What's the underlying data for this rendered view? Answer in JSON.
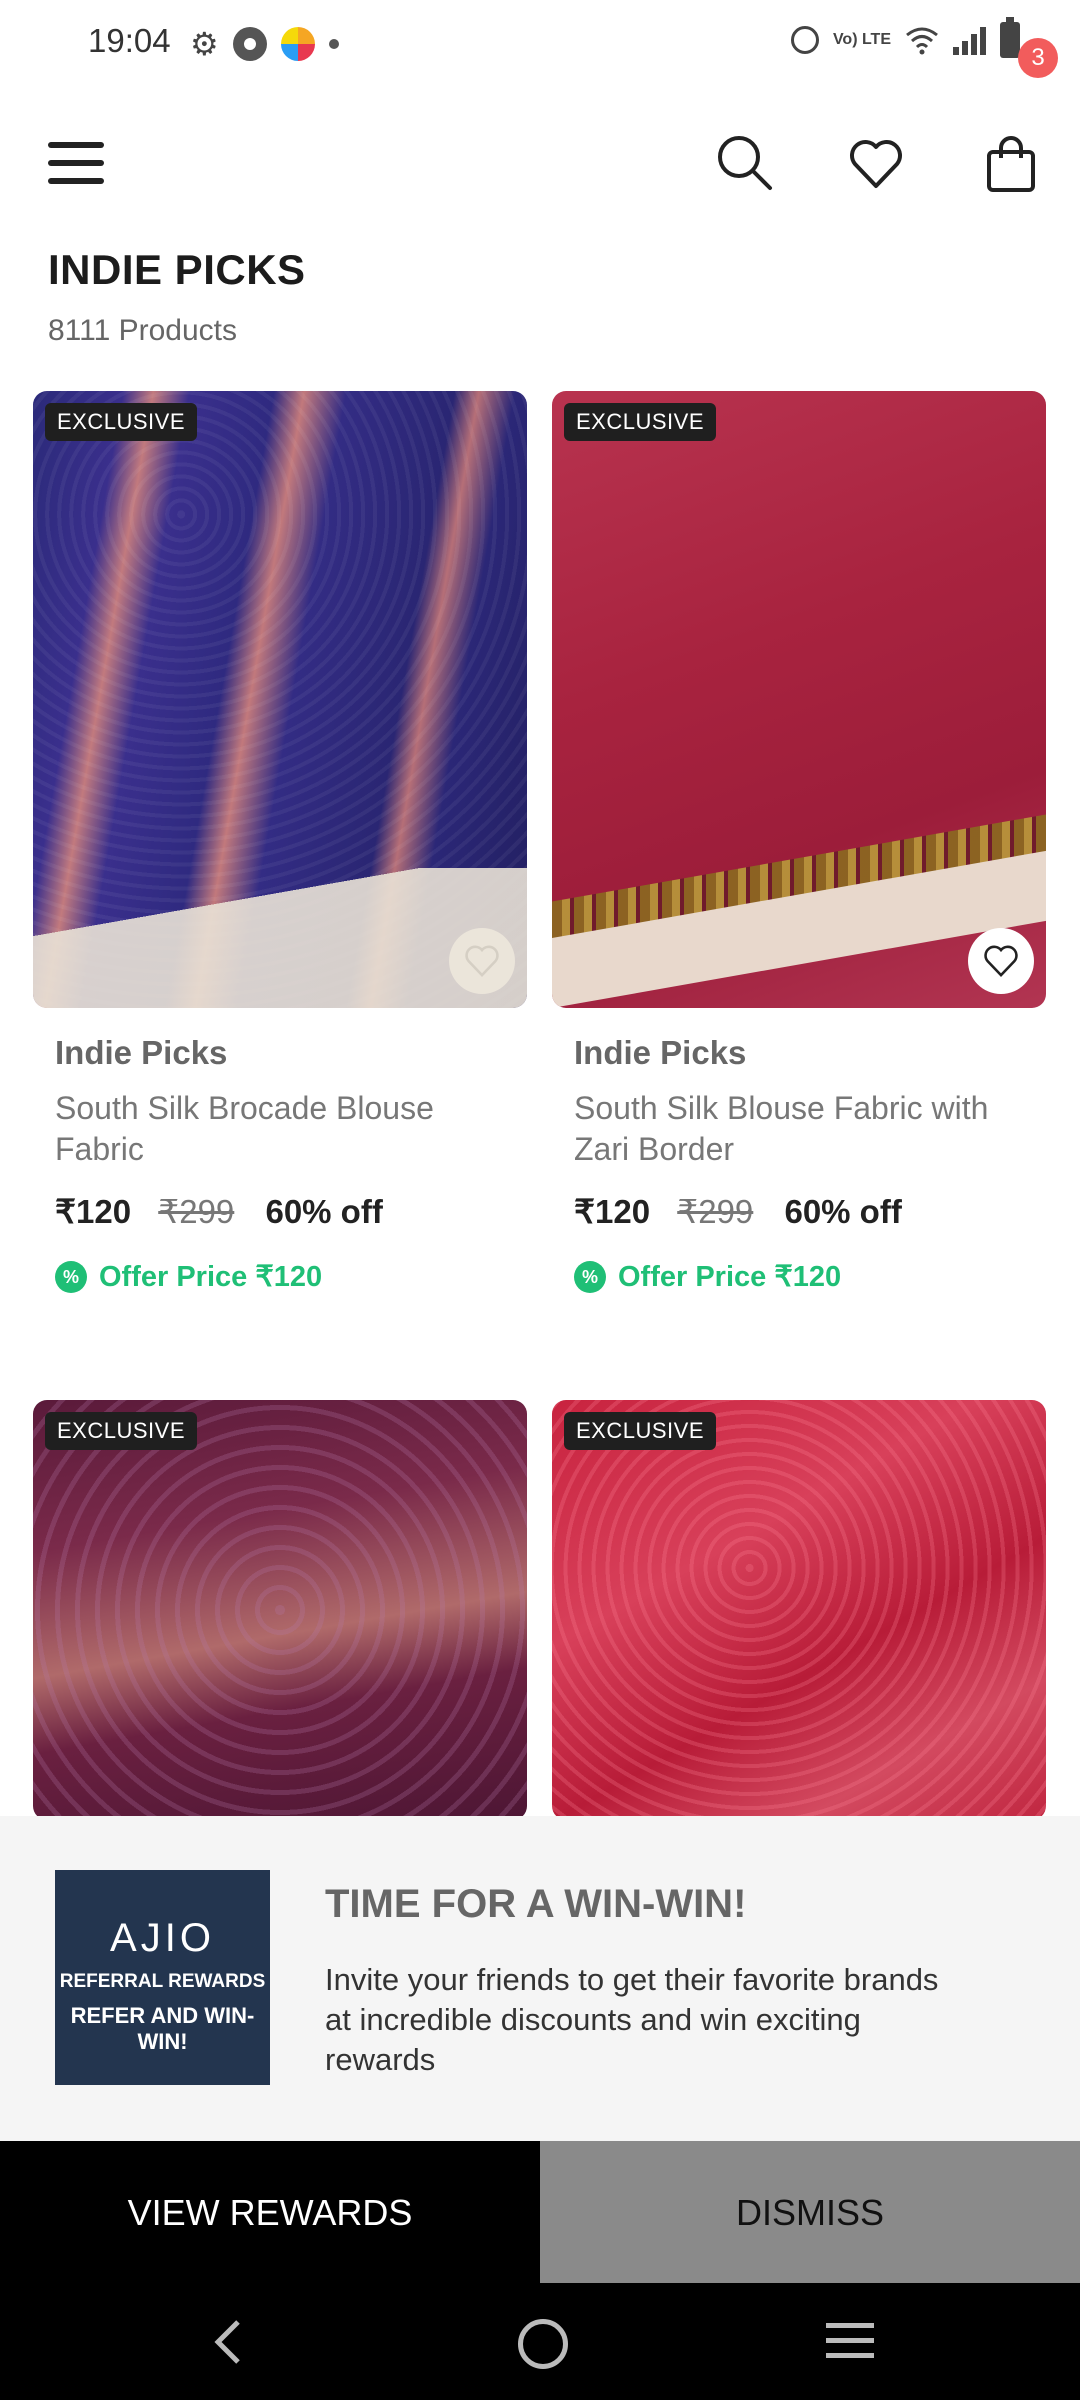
{
  "status_bar": {
    "time": "19:04",
    "network_label": "Vo) LTE"
  },
  "header": {
    "cart_count": "3"
  },
  "page": {
    "title": "INDIE PICKS",
    "product_count": "8111 Products"
  },
  "products": [
    {
      "badge": "EXCLUSIVE",
      "brand": "Indie Picks",
      "name": "South Silk Brocade Blouse Fabric",
      "price": "₹120",
      "mrp": "₹299",
      "discount": "60% off",
      "offer": "Offer Price ₹120"
    },
    {
      "badge": "EXCLUSIVE",
      "brand": "Indie Picks",
      "name": "South Silk Blouse Fabric with Zari Border",
      "price": "₹120",
      "mrp": "₹299",
      "discount": "60% off",
      "offer": "Offer Price ₹120"
    },
    {
      "badge": "EXCLUSIVE"
    },
    {
      "badge": "EXCLUSIVE"
    }
  ],
  "promo": {
    "image_lines": [
      "AJIO",
      "REFERRAL REWARDS",
      "REFER AND WIN-WIN!"
    ],
    "title": "TIME FOR A WIN-WIN!",
    "body": "Invite your friends to get their favorite brands at incredible discounts and win exciting rewards",
    "primary_button": "VIEW REWARDS",
    "secondary_button": "DISMISS"
  },
  "colors": {
    "offer_green": "#1fbf76",
    "badge_red": "#f25c5c",
    "promo_navy": "#23354f"
  }
}
